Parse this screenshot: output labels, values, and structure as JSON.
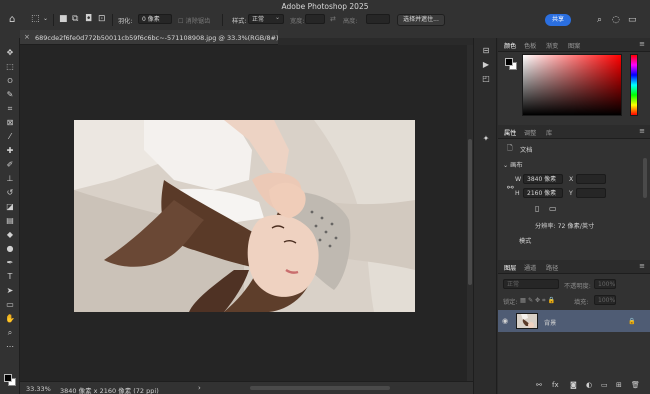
{
  "app": {
    "title": "Adobe Photoshop 2025"
  },
  "options_bar": {
    "feather_label": "羽化:",
    "feather_value": "0 像素",
    "antialias_label": "消除锯齿",
    "style_label": "样式:",
    "style_value": "正常",
    "width_label": "宽度:",
    "height_label": "高度:",
    "select_subject": "选择并遮住...",
    "share": "共享"
  },
  "document": {
    "tab_title": "689cde2f6fe0d772b50011cb59f6c6bc~-571108908.jpg @ 33.3%(RGB/8#)",
    "close_symbol": "×"
  },
  "status": {
    "zoom": "33.33%",
    "info": "3840 像素 x 2160 像素 (72 ppi)",
    "arrow": "›"
  },
  "color_panel": {
    "tabs": [
      "颜色",
      "色板",
      "渐变",
      "图案"
    ],
    "active_tab": 0
  },
  "properties_panel": {
    "tabs": [
      "属性",
      "调整",
      "库"
    ],
    "active_tab": 0,
    "doc_label": "文档",
    "section": "画布",
    "w_label": "W",
    "w_value": "3840 像素",
    "x_label": "X",
    "h_label": "H",
    "h_value": "2160 像素",
    "y_label": "Y",
    "resolution": "分辨率: 72 像素/英寸",
    "mode_label": "模式"
  },
  "layers_panel": {
    "tabs": [
      "图层",
      "通道",
      "路径"
    ],
    "active_tab": 0,
    "blend_mode": "正常",
    "opacity_label": "不透明度:",
    "opacity_value": "100%",
    "lock_label": "锁定:",
    "fill_label": "填充:",
    "fill_value": "100%",
    "layer_name": "背景",
    "bottom_buttons": [
      "link-icon",
      "fx-icon",
      "mask-icon",
      "adjustment-icon",
      "group-icon",
      "new-layer-icon",
      "trash-icon"
    ]
  },
  "colors": {
    "share_button": "#2b6fe0",
    "selected_layer": "#4f5c74",
    "canvas_bg": "#252525"
  }
}
